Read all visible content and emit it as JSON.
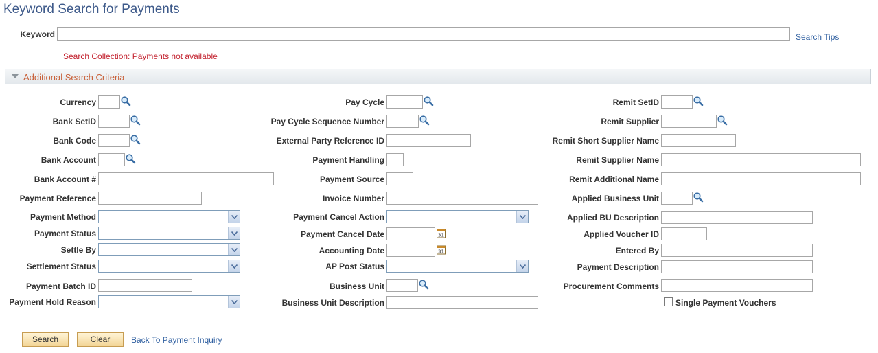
{
  "page": {
    "title": "Keyword Search for Payments"
  },
  "keyword": {
    "label": "Keyword",
    "value": "",
    "search_tips": "Search Tips"
  },
  "message": "Search Collection: Payments not available",
  "additional": {
    "label": "Additional Search Criteria"
  },
  "fields": {
    "currency": "Currency",
    "bank_setid": "Bank SetID",
    "bank_code": "Bank Code",
    "bank_account": "Bank Account",
    "bank_account_num": "Bank Account #",
    "payment_reference": "Payment Reference",
    "payment_method": "Payment Method",
    "payment_status": "Payment Status",
    "settle_by": "Settle By",
    "settlement_status": "Settlement Status",
    "payment_batch_id": "Payment Batch ID",
    "payment_hold_reason": "Payment Hold Reason",
    "pay_cycle": "Pay Cycle",
    "pay_cycle_seq": "Pay Cycle Sequence Number",
    "external_party_ref": "External Party Reference ID",
    "payment_handling": "Payment Handling",
    "payment_source": "Payment Source",
    "invoice_number": "Invoice Number",
    "payment_cancel_action": "Payment Cancel Action",
    "payment_cancel_date": "Payment Cancel Date",
    "accounting_date": "Accounting Date",
    "ap_post_status": "AP Post Status",
    "business_unit": "Business Unit",
    "business_unit_desc": "Business Unit Description",
    "remit_setid": "Remit SetID",
    "remit_supplier": "Remit Supplier",
    "remit_short_supplier_name": "Remit Short Supplier Name",
    "remit_supplier_name": "Remit Supplier Name",
    "remit_additional_name": "Remit Additional Name",
    "applied_business_unit": "Applied Business Unit",
    "applied_bu_desc": "Applied BU Description",
    "applied_voucher_id": "Applied Voucher ID",
    "entered_by": "Entered By",
    "payment_description": "Payment Description",
    "procurement_comments": "Procurement Comments",
    "single_payment_vouchers": "Single Payment Vouchers"
  },
  "actions": {
    "search": "Search",
    "clear": "Clear",
    "back": "Back To Payment Inquiry"
  }
}
